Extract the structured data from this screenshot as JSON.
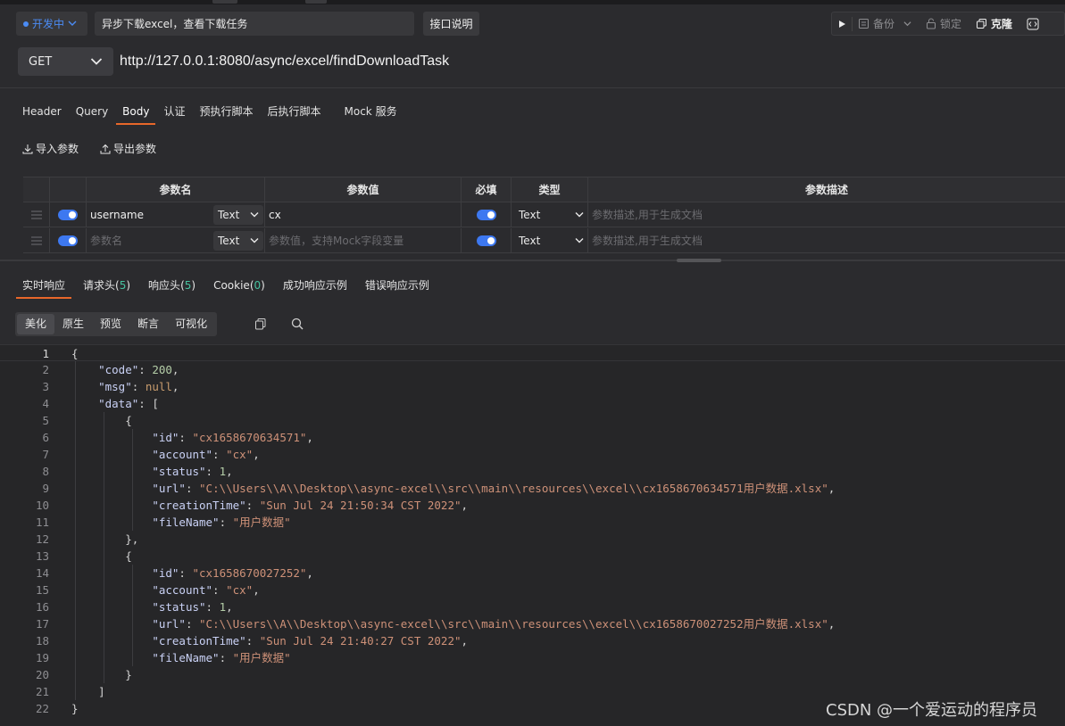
{
  "header": {
    "env_status": "开发中",
    "api_name": "异步下载excel，查看下载任务",
    "doc_button": "接口说明",
    "toolbar": {
      "backup_label": "备份",
      "lock_label": "锁定",
      "clone_label": "克隆"
    }
  },
  "request": {
    "method": "GET",
    "url": "http://127.0.0.1:8080/async/excel/findDownloadTask",
    "tabs": [
      "Header",
      "Query",
      "Body",
      "认证",
      "预执行脚本",
      "后执行脚本",
      "Mock 服务"
    ],
    "active_tab": "Body",
    "import_label": "导入参数",
    "export_label": "导出参数",
    "table": {
      "headers": {
        "name": "参数名",
        "value": "参数值",
        "required": "必填",
        "type": "类型",
        "desc": "参数描述"
      },
      "rows": [
        {
          "name": "username",
          "name_type": "Text",
          "value": "cx",
          "type": "Text",
          "desc_placeholder": "参数描述,用于生成文档"
        },
        {
          "name_placeholder": "参数名",
          "name_type": "Text",
          "value_placeholder": "参数值，支持Mock字段变量",
          "type": "Text",
          "desc_placeholder": "参数描述,用于生成文档"
        }
      ]
    }
  },
  "response": {
    "tabs": {
      "realtime": "实时响应",
      "req_headers": "请求头",
      "req_headers_count": "5",
      "resp_headers": "响应头",
      "resp_headers_count": "5",
      "cookie": "Cookie",
      "cookie_count": "0",
      "success_example": "成功响应示例",
      "error_example": "错误响应示例"
    },
    "views": [
      "美化",
      "原生",
      "预览",
      "断言",
      "可视化"
    ],
    "active_view": "美化",
    "code_lines": [
      "{",
      "    \"code\": 200,",
      "    \"msg\": null,",
      "    \"data\": [",
      "        {",
      "            \"id\": \"cx1658670634571\",",
      "            \"account\": \"cx\",",
      "            \"status\": 1,",
      "            \"url\": \"C:\\\\Users\\\\A\\\\Desktop\\\\async-excel\\\\src\\\\main\\\\resources\\\\excel\\\\cx1658670634571用户数据.xlsx\",",
      "            \"creationTime\": \"Sun Jul 24 21:50:34 CST 2022\",",
      "            \"fileName\": \"用户数据\"",
      "        },",
      "        {",
      "            \"id\": \"cx1658670027252\",",
      "            \"account\": \"cx\",",
      "            \"status\": 1,",
      "            \"url\": \"C:\\\\Users\\\\A\\\\Desktop\\\\async-excel\\\\src\\\\main\\\\resources\\\\excel\\\\cx1658670027252用户数据.xlsx\",",
      "            \"creationTime\": \"Sun Jul 24 21:40:27 CST 2022\",",
      "            \"fileName\": \"用户数据\"",
      "        }",
      "    ]",
      "}"
    ]
  },
  "watermark": "CSDN @一个爱运动的程序员"
}
